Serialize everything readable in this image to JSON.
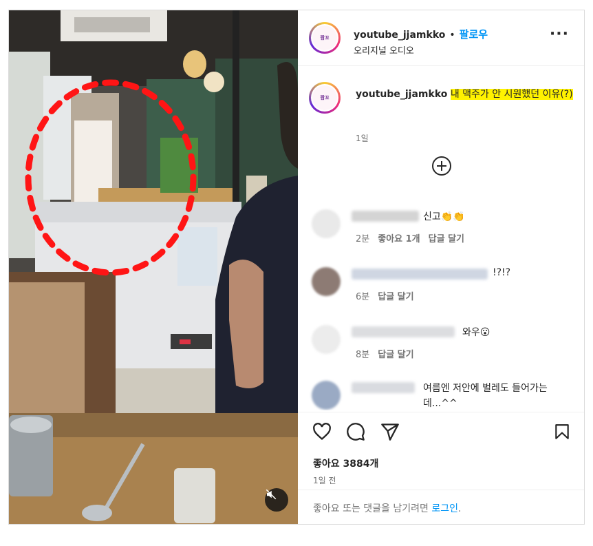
{
  "header": {
    "username": "youtube_jjamkko",
    "separator": "•",
    "follow_label": "팔로우",
    "audio_label": "오리지널 오디오",
    "more_icon": "more-horizontal-icon",
    "avatar_text": "짬꼬"
  },
  "caption": {
    "username": "youtube_jjamkko",
    "text": "내 맥주가 안 시원했던 이유(?)",
    "time": "1일"
  },
  "comments": [
    {
      "text": "신고👏👏",
      "time": "2분",
      "likes": "좋아요 1개",
      "reply": "답글 달기"
    },
    {
      "text": "!?!?",
      "time": "6분",
      "reply": "답글 달기"
    },
    {
      "text": "와우😮",
      "time": "8분",
      "reply": "답글 달기"
    },
    {
      "text": "여름엔 저안에 벌레도 들어가는데...^^"
    }
  ],
  "actions": {
    "like_icon": "heart-icon",
    "comment_icon": "comment-icon",
    "share_icon": "send-icon",
    "save_icon": "bookmark-icon",
    "likes_text": "좋아요 3884개",
    "posted_ago": "1일 전"
  },
  "login_prompt": {
    "text": "좋아요 또는 댓글을 남기려면",
    "link": "로그인",
    "suffix": "."
  },
  "media": {
    "mute_icon": "speaker-muted-icon"
  }
}
